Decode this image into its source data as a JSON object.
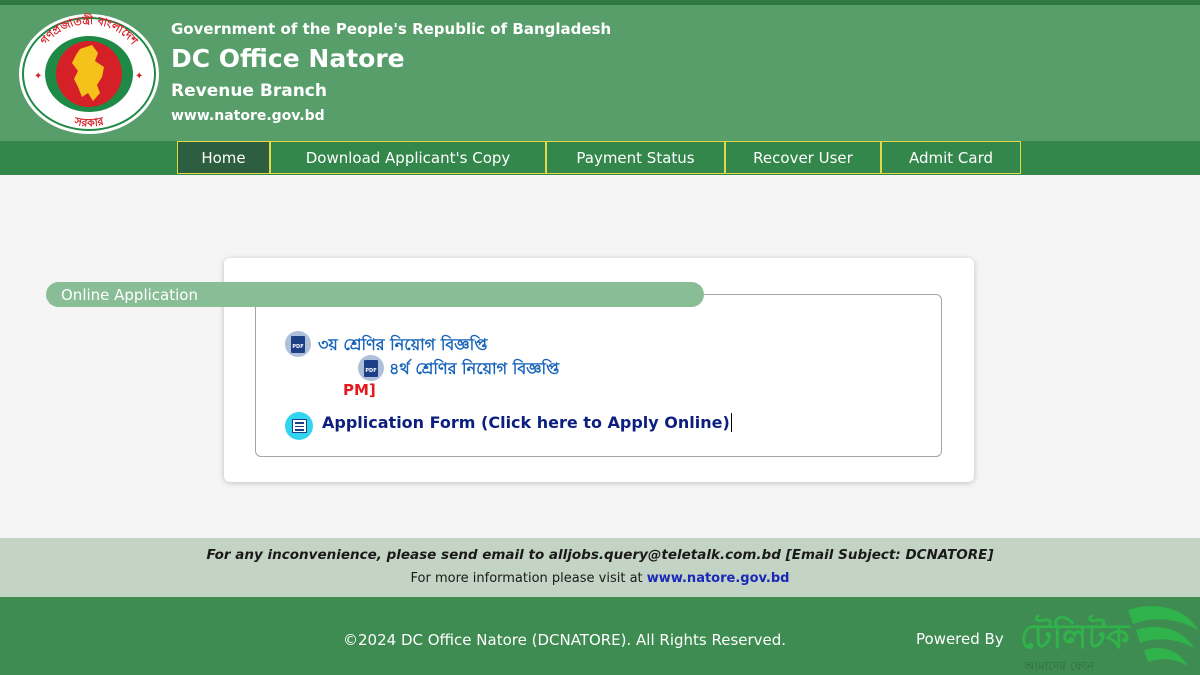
{
  "header": {
    "government": "Government of the People's Republic of Bangladesh",
    "title": "DC Office Natore",
    "branch": "Revenue Branch",
    "website": "www.natore.gov.bd",
    "seal_text_top": "গণপ্রজাতন্ত্রী বাংলাদেশ",
    "seal_text_bottom": "সরকার"
  },
  "nav": {
    "items": [
      {
        "label": "Home",
        "active": true
      },
      {
        "label": "Download Applicant's Copy",
        "active": false
      },
      {
        "label": "Payment Status",
        "active": false
      },
      {
        "label": "Recover User",
        "active": false
      },
      {
        "label": "Admit Card",
        "active": false
      }
    ]
  },
  "main": {
    "section_title": "Online Application",
    "notices": [
      {
        "icon": "pdf-icon",
        "icon_text": "PDF",
        "label": "৩য় শ্রেণির নিয়োগ বিজ্ঞপ্তি"
      },
      {
        "icon": "pdf-icon",
        "icon_text": "PDF",
        "label": "৪র্থ শ্রেণির নিয়োগ বিজ্ঞপ্তি"
      }
    ],
    "partial_text": "PM]",
    "apply_link": "Application Form (Click here to Apply Online)",
    "apply_icon": "form-icon"
  },
  "info": {
    "email_notice": "For any inconvenience, please send email to alljobs.query@teletalk.com.bd [Email Subject: DCNATORE]",
    "more_info_prefix": "For more information please visit at",
    "more_info_link": "www.natore.gov.bd"
  },
  "footer": {
    "copyright": "©2024 DC Office Natore (DCNATORE). All Rights Reserved.",
    "powered_by": "Powered By",
    "brand_text": "টেলিটক",
    "brand_subtext": "আমাদের ফোন"
  },
  "colors": {
    "header_green": "#589e6b",
    "nav_green": "#33874b",
    "nav_border": "#e3d845",
    "footer_green": "#3f8c52",
    "info_bar": "#c3d3c4",
    "legend_green": "#89bd96",
    "link_blue": "#1764b9",
    "alert_red": "#e3191c"
  }
}
